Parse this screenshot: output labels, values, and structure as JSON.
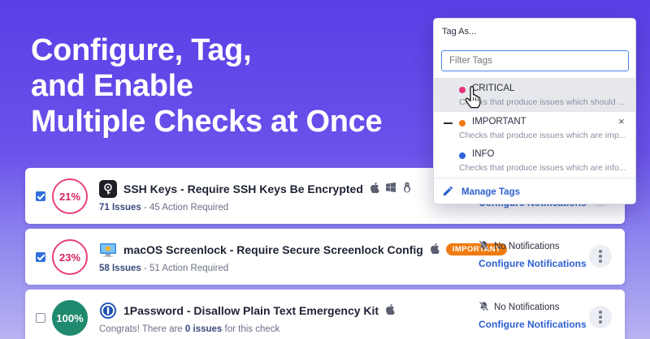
{
  "headline": {
    "line1": "Configure, Tag,",
    "line2": "and Enable",
    "line3": "Multiple Checks at Once"
  },
  "checks": [
    {
      "checked": true,
      "percent": "21%",
      "icon": "ssh-key-icon",
      "title": "SSH Keys - Require SSH Keys Be Encrypted",
      "platforms": [
        "apple-icon",
        "windows-icon",
        "linux-icon"
      ],
      "issues_count": "71 Issues",
      "action_text": "- 45 Action Required",
      "notification": "",
      "configure": "Configure Notifications"
    },
    {
      "checked": true,
      "percent": "23%",
      "icon": "macos-screenlock-icon",
      "title": "macOS Screenlock - Require Secure Screenlock Config",
      "platforms": [
        "apple-icon"
      ],
      "badge": "IMPORTANT",
      "issues_count": "58 Issues",
      "action_text": "- 51 Action Required",
      "notification": "No Notifications",
      "configure": "Configure Notifications"
    },
    {
      "checked": false,
      "percent": "100%",
      "icon": "1password-icon",
      "title": "1Password - Disallow Plain Text Emergency Kit",
      "platforms": [
        "apple-icon"
      ],
      "congrats_pre": "Congrats! There are ",
      "congrats_bold": "0 issues",
      "congrats_post": " for this check",
      "notification": "No Notifications",
      "configure": "Configure Notifications"
    }
  ],
  "tag_menu": {
    "header": "Tag As...",
    "filter_placeholder": "Filter Tags",
    "tags": [
      {
        "name": "CRITICAL",
        "color": "#e8327c",
        "desc": "Checks that produce issues which should ...",
        "hovered": true
      },
      {
        "name": "IMPORTANT",
        "color": "#ef7a14",
        "desc": "Checks that produce issues which are imp...",
        "applied": true
      },
      {
        "name": "INFO",
        "color": "#2f64d8",
        "desc": "Checks that produce issues which are info..."
      }
    ],
    "remove_glyph": "×",
    "manage": "Manage Tags"
  },
  "colors": {
    "accent": "#2d5fd1",
    "critical": "#e8327c",
    "important": "#ef7a14",
    "info": "#2f64d8",
    "success": "#1f8a6e"
  }
}
